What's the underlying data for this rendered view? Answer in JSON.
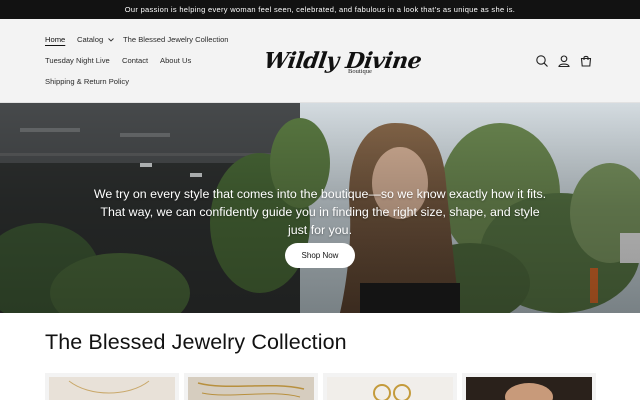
{
  "announcement": {
    "text": "Our passion is helping every woman feel seen, celebrated, and fabulous in a look that’s as unique as she is."
  },
  "nav": {
    "items": [
      {
        "label": "Home",
        "active": true
      },
      {
        "label": "Catalog",
        "has_dropdown": true
      },
      {
        "label": "The Blessed Jewelry Collection"
      },
      {
        "label": "Tuesday Night Live"
      },
      {
        "label": "Contact"
      },
      {
        "label": "About Us"
      },
      {
        "label": "Shipping & Return Policy"
      }
    ]
  },
  "logo": {
    "main": "Wildly Divine",
    "sub": "Boutique"
  },
  "header_icons": [
    "search-icon",
    "account-icon",
    "cart-icon"
  ],
  "hero": {
    "text": "We try on every style that comes into the boutique—so we know exactly how it fits. That way, we can confidently guide you in finding the right size, shape, and style just for you.",
    "button_label": "Shop Now"
  },
  "collection": {
    "title": "The Blessed Jewelry Collection",
    "products": [
      {
        "image": "necklace-light-background"
      },
      {
        "image": "gold-chain-necklace"
      },
      {
        "image": "gold-hoop-earrings"
      },
      {
        "image": "model-wearing-necklace"
      }
    ]
  },
  "colors": {
    "announcement_bg": "#121212",
    "header_bg": "#f3f3f3",
    "button_bg": "#ffffff",
    "text": "#121212"
  }
}
